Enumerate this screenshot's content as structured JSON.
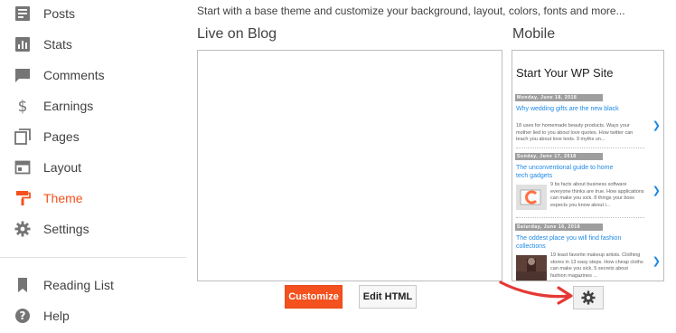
{
  "sidebar": {
    "items": [
      {
        "label": "Posts",
        "icon": "posts-icon"
      },
      {
        "label": "Stats",
        "icon": "stats-icon"
      },
      {
        "label": "Comments",
        "icon": "comments-icon"
      },
      {
        "label": "Earnings",
        "icon": "dollar-icon"
      },
      {
        "label": "Pages",
        "icon": "pages-icon"
      },
      {
        "label": "Layout",
        "icon": "layout-icon"
      },
      {
        "label": "Theme",
        "icon": "theme-roller-icon",
        "active": true
      },
      {
        "label": "Settings",
        "icon": "gear-icon"
      }
    ],
    "secondary": [
      {
        "label": "Reading List",
        "icon": "bookmark-icon"
      },
      {
        "label": "Help",
        "icon": "help-icon"
      }
    ],
    "active_color": "#f4511e"
  },
  "main": {
    "intro": "Start with a base theme and customize your background, layout, colors, fonts and more...",
    "live_title": "Live on Blog",
    "mobile_title": "Mobile",
    "customize_label": "Customize",
    "edit_html_label": "Edit HTML",
    "accent_color": "#f4511e"
  },
  "mobile_preview": {
    "site_title": "Start Your WP Site",
    "posts": [
      {
        "date": "Monday, June 18, 2018",
        "title": "Why wedding gifts are the new black",
        "excerpt": "18 uses for homemade beauty products. Ways your mother lied to you about love quotes. How twitter can teach you about love tests. 9 myths un..."
      },
      {
        "date": "Sunday, June 17, 2018",
        "title": "The unconventional guide to home tech gadgets",
        "excerpt": "9 bs facts about business software everyone thinks are true. How applications can make you sick. 8 things your boss expects you know about i..."
      },
      {
        "date": "Saturday, June 16, 2018",
        "title": "The oddest place you will find fashion collections",
        "excerpt": "19 least favorite makeup artists. Clothing stores in 13 easy steps. How cheap cloths can make you sick. 5 secrets about fashion magazines ..."
      }
    ]
  }
}
